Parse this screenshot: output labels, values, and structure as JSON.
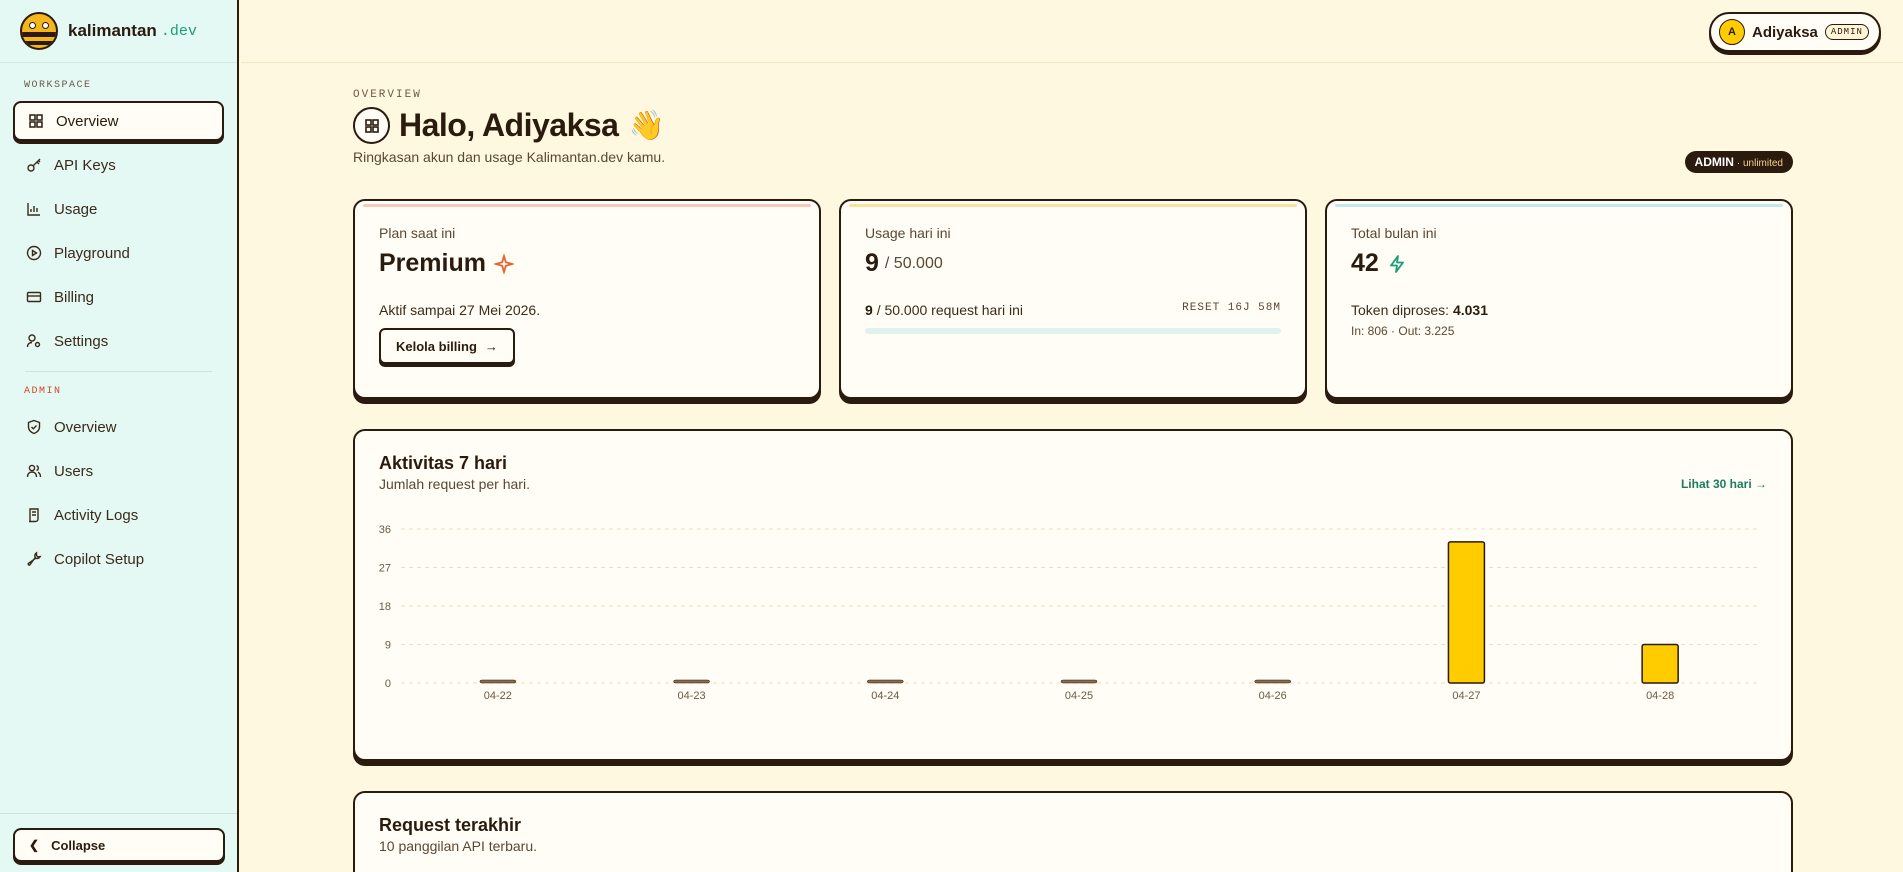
{
  "brand": {
    "name": "kalimantan",
    "tld": ".dev"
  },
  "sidebar": {
    "workspace_label": "WORKSPACE",
    "workspace_items": [
      {
        "label": "Overview",
        "icon": "grid-icon",
        "active": true
      },
      {
        "label": "API Keys",
        "icon": "key-icon"
      },
      {
        "label": "Usage",
        "icon": "bar-chart-icon"
      },
      {
        "label": "Playground",
        "icon": "play-icon"
      },
      {
        "label": "Billing",
        "icon": "credit-card-icon"
      },
      {
        "label": "Settings",
        "icon": "user-cog-icon"
      }
    ],
    "admin_label": "ADMIN",
    "admin_items": [
      {
        "label": "Overview",
        "icon": "shield-icon"
      },
      {
        "label": "Users",
        "icon": "users-icon"
      },
      {
        "label": "Activity Logs",
        "icon": "scroll-icon"
      },
      {
        "label": "Copilot Setup",
        "icon": "wrench-icon"
      }
    ],
    "collapse_label": "Collapse"
  },
  "header": {
    "user_initial": "A",
    "user_name": "Adiyaksa",
    "role_tag": "ADMIN"
  },
  "page": {
    "eyebrow": "OVERVIEW",
    "title": "Halo, Adiyaksa",
    "wave": "👋",
    "subtitle": "Ringkasan akun dan usage Kalimantan.dev kamu.",
    "role_badge": "ADMIN",
    "role_badge_suffix": "· unlimited"
  },
  "cards": {
    "plan": {
      "label": "Plan saat ini",
      "value": "Premium",
      "active_until": "Aktif sampai 27 Mei 2026.",
      "button": "Kelola billing",
      "stripe_color": "#f6c9b8"
    },
    "usage": {
      "label": "Usage hari ini",
      "value": "9",
      "limit": "/ 50.000",
      "used": "9",
      "row_text": "/ 50.000 request hari ini",
      "reset": "RESET 16J 58M",
      "progress": 0.00018,
      "stripe_color": "#f7e39a"
    },
    "total": {
      "label": "Total bulan ini",
      "value": "42",
      "tokens_label": "Token diproses:",
      "tokens_value": "4.031",
      "breakdown": "In: 806 · Out: 3.225",
      "stripe_color": "#bfe9f0"
    }
  },
  "activity": {
    "title": "Aktivitas 7 hari",
    "subtitle": "Jumlah request per hari.",
    "link": "Lihat 30 hari →"
  },
  "recent": {
    "title": "Request terakhir",
    "subtitle": "10 panggilan API terbaru."
  },
  "chart_data": {
    "type": "bar",
    "categories": [
      "04-22",
      "04-23",
      "04-24",
      "04-25",
      "04-26",
      "04-27",
      "04-28"
    ],
    "values": [
      0,
      0,
      0,
      0,
      0,
      33,
      9
    ],
    "yticks": [
      0,
      9,
      18,
      27,
      36
    ],
    "ylim": [
      0,
      36
    ],
    "bar_color": "#ffcc00",
    "grid": true
  }
}
